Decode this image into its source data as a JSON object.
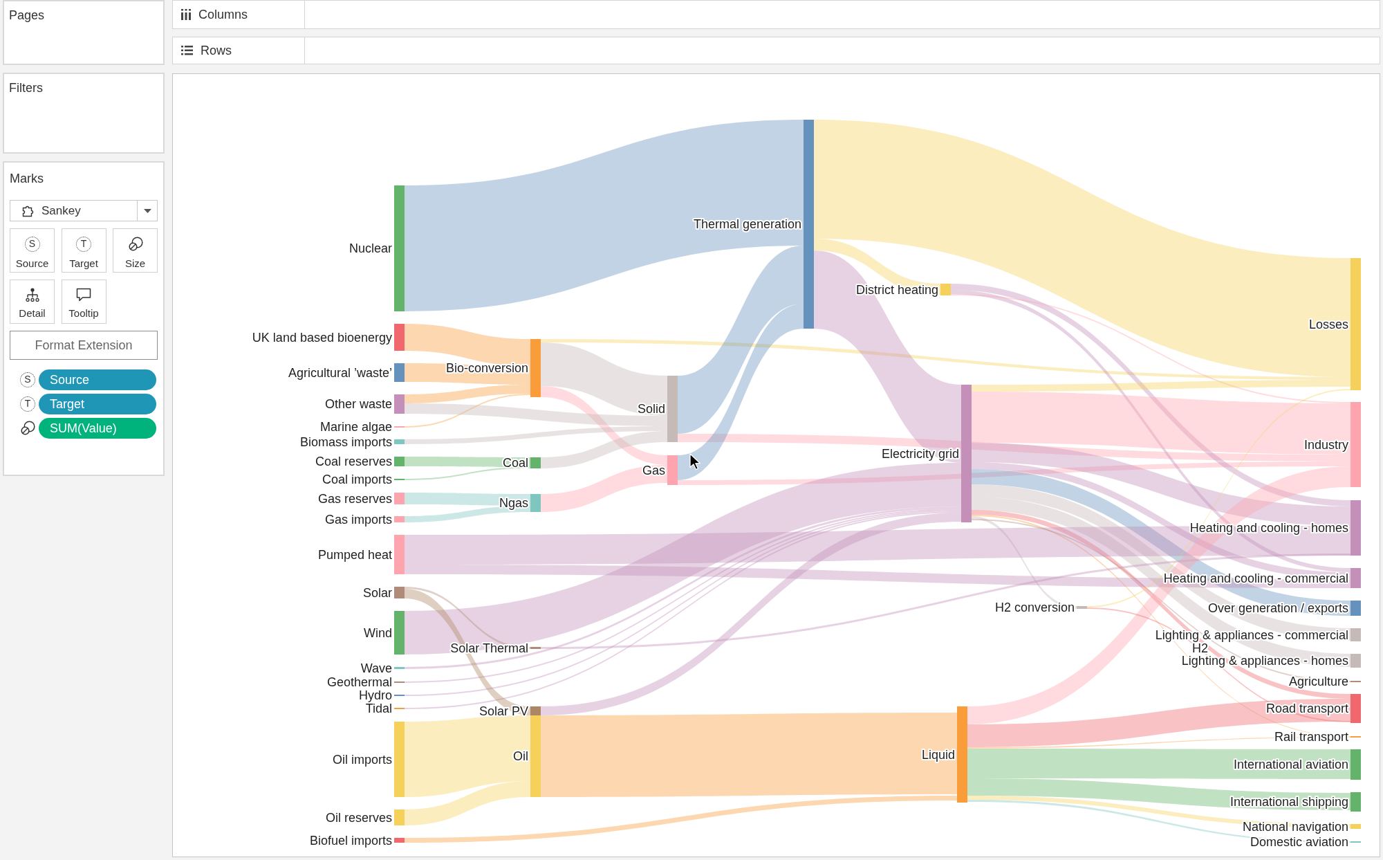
{
  "left_panel": {
    "pages": {
      "title": "Pages"
    },
    "filters": {
      "title": "Filters"
    },
    "marks": {
      "title": "Marks",
      "mark_type": "Sankey",
      "buttons": [
        {
          "label": "Source",
          "kind": "letter",
          "icon": "S"
        },
        {
          "label": "Target",
          "kind": "letter",
          "icon": "T"
        },
        {
          "label": "Size",
          "kind": "size"
        },
        {
          "label": "Detail",
          "kind": "detail"
        },
        {
          "label": "Tooltip",
          "kind": "tooltip"
        }
      ],
      "format_button": "Format Extension",
      "fields": [
        {
          "label": "Source",
          "kind": "letter",
          "icon": "S",
          "color": "#1f96b5"
        },
        {
          "label": "Target",
          "kind": "letter",
          "icon": "T",
          "color": "#1f96b5"
        },
        {
          "label": "SUM(Value)",
          "kind": "size",
          "color": "#00b37c"
        }
      ]
    }
  },
  "shelves": [
    {
      "label": "Columns",
      "kind": "columns"
    },
    {
      "label": "Rows",
      "kind": "rows"
    }
  ],
  "sankey": {
    "nodes": [
      {
        "label": "Nuclear",
        "color": "#63b36a"
      },
      {
        "label": "UK land based bioenergy",
        "color": "#f0686e"
      },
      {
        "label": "Agricultural ’waste’",
        "color": "#6592bd"
      },
      {
        "label": "Other waste",
        "color": "#c48fb8"
      },
      {
        "label": "Marine algae",
        "color": "#fea4ae"
      },
      {
        "label": "Biomass imports",
        "color": "#7ec6c0"
      },
      {
        "label": "Coal reserves",
        "color": "#63b36a"
      },
      {
        "label": "Coal imports",
        "color": "#63b36a"
      },
      {
        "label": "Gas reserves",
        "color": "#fea4ae"
      },
      {
        "label": "Gas imports",
        "color": "#fea4ae"
      },
      {
        "label": "Pumped heat",
        "color": "#fea4ae"
      },
      {
        "label": "Solar",
        "color": "#b08b7a"
      },
      {
        "label": "Wind",
        "color": "#63b36a"
      },
      {
        "label": "Wave",
        "color": "#7ec6c0"
      },
      {
        "label": "Geothermal",
        "color": "#b08b7a"
      },
      {
        "label": "Hydro",
        "color": "#6592bd"
      },
      {
        "label": "Tidal",
        "color": "#f99c3a"
      },
      {
        "label": "Oil imports",
        "color": "#f5d15b"
      },
      {
        "label": "Oil reserves",
        "color": "#f5d15b"
      },
      {
        "label": "Biofuel imports",
        "color": "#f0686e"
      },
      {
        "label": "Bio-conversion",
        "color": "#f99c3a"
      },
      {
        "label": "Coal",
        "color": "#63b36a"
      },
      {
        "label": "Ngas",
        "color": "#7ec6c0"
      },
      {
        "label": "Solar Thermal",
        "color": "#b08b7a"
      },
      {
        "label": "Solar PV",
        "color": "#ad8664"
      },
      {
        "label": "Oil",
        "color": "#f5d15b"
      },
      {
        "label": "Solid",
        "color": "#c5bab7"
      },
      {
        "label": "Gas",
        "color": "#fea4ae"
      },
      {
        "label": "Thermal generation",
        "color": "#6592bd"
      },
      {
        "label": "District heating",
        "color": "#f5d15b"
      },
      {
        "label": "Electricity grid",
        "color": "#c48fb8"
      },
      {
        "label": "Liquid",
        "color": "#f99c3a"
      },
      {
        "label": "H2 conversion",
        "color": "#c5bab7"
      },
      {
        "label": "H2"
      },
      {
        "label": "Losses",
        "color": "#f5d15b"
      },
      {
        "label": "Industry",
        "color": "#fea4ae"
      },
      {
        "label": "Heating and cooling - homes",
        "color": "#c48fb8"
      },
      {
        "label": "Heating and cooling - commercial",
        "color": "#c48fb8"
      },
      {
        "label": "Over generation / exports",
        "color": "#6592bd"
      },
      {
        "label": "Lighting & appliances - commercial",
        "color": "#c5bab7"
      },
      {
        "label": "Lighting & appliances - homes",
        "color": "#c5bab7"
      },
      {
        "label": "Agriculture",
        "color": "#b08b7a"
      },
      {
        "label": "Road transport",
        "color": "#f0686e"
      },
      {
        "label": "Rail transport",
        "color": "#f99c3a"
      },
      {
        "label": "International aviation",
        "color": "#63b36a"
      },
      {
        "label": "International shipping",
        "color": "#63b36a"
      },
      {
        "label": "National navigation",
        "color": "#f5d15b"
      },
      {
        "label": "Domestic aviation",
        "color": "#7ec6c0"
      }
    ]
  }
}
